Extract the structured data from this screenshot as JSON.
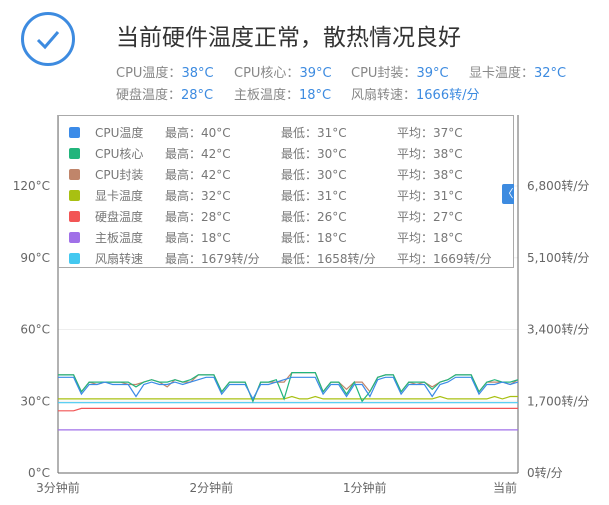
{
  "header": {
    "title": "当前硬件温度正常，散热情况良好",
    "summary": [
      {
        "label": "CPU温度：",
        "value": "38°C"
      },
      {
        "label": "CPU核心：",
        "value": "39°C"
      },
      {
        "label": "CPU封装：",
        "value": "39°C"
      },
      {
        "label": "显卡温度：",
        "value": "32°C"
      },
      {
        "label": "硬盘温度：",
        "value": "28°C"
      },
      {
        "label": "主板温度：",
        "value": "18°C"
      },
      {
        "label": "风扇转速：",
        "value": "1666转/分"
      }
    ]
  },
  "legend": {
    "toggle": "〈",
    "items": [
      {
        "name": "CPU温度",
        "max": "最高：40°C",
        "min": "最低：31°C",
        "avg": "平均：37°C",
        "color": "#3b8be8"
      },
      {
        "name": "CPU核心",
        "max": "最高：42°C",
        "min": "最低：30°C",
        "avg": "平均：38°C",
        "color": "#22b57c"
      },
      {
        "name": "CPU封装",
        "max": "最高：42°C",
        "min": "最低：30°C",
        "avg": "平均：38°C",
        "color": "#c0856a"
      },
      {
        "name": "显卡温度",
        "max": "最高：32°C",
        "min": "最低：31°C",
        "avg": "平均：31°C",
        "color": "#a8c012"
      },
      {
        "name": "硬盘温度",
        "max": "最高：28°C",
        "min": "最低：26°C",
        "avg": "平均：27°C",
        "color": "#f25555"
      },
      {
        "name": "主板温度",
        "max": "最高：18°C",
        "min": "最低：18°C",
        "avg": "平均：18°C",
        "color": "#a070e8"
      },
      {
        "name": "风扇转速",
        "max": "最高：1679转/分",
        "min": "最低：1658转/分",
        "avg": "平均：1669转/分",
        "color": "#44c8f0"
      }
    ]
  },
  "chart_data": {
    "type": "line",
    "x_ticks": [
      "3分钟前",
      "2分钟前",
      "1分钟前",
      "当前"
    ],
    "y_left": {
      "ticks": [
        "0°C",
        "30°C",
        "60°C",
        "90°C",
        "120°C"
      ],
      "range": [
        0,
        120
      ]
    },
    "y_right": {
      "ticks": [
        "0转/分",
        "1,700转/分",
        "3,400转/分",
        "5,100转/分",
        "6,800转/分"
      ],
      "range": [
        0,
        6800
      ]
    },
    "series": [
      {
        "name": "CPU温度",
        "axis": "left",
        "values": [
          40,
          40,
          40,
          33,
          37,
          37,
          38,
          37,
          37,
          37,
          32,
          37,
          38,
          37,
          37,
          38,
          37,
          38,
          39,
          40,
          40,
          33,
          37,
          37,
          37,
          31,
          37,
          37,
          38,
          39,
          40,
          40,
          40,
          40,
          33,
          37,
          37,
          32,
          37,
          37,
          32,
          39,
          40,
          40,
          33,
          37,
          37,
          37,
          32,
          37,
          38,
          40,
          40,
          40,
          33,
          37,
          37,
          38,
          37,
          38
        ]
      },
      {
        "name": "CPU核心",
        "axis": "left",
        "values": [
          41,
          41,
          41,
          34,
          38,
          38,
          38,
          38,
          38,
          38,
          36,
          38,
          39,
          38,
          38,
          39,
          38,
          39,
          41,
          41,
          41,
          34,
          38,
          38,
          38,
          30,
          38,
          38,
          39,
          31,
          42,
          42,
          42,
          42,
          34,
          38,
          38,
          33,
          38,
          30,
          34,
          40,
          41,
          41,
          34,
          38,
          38,
          38,
          35,
          38,
          39,
          41,
          41,
          41,
          34,
          38,
          39,
          38,
          38,
          39
        ]
      },
      {
        "name": "CPU封装",
        "axis": "left",
        "values": [
          41,
          41,
          41,
          34,
          38,
          37,
          38,
          38,
          38,
          37,
          37,
          38,
          39,
          38,
          36,
          39,
          38,
          38,
          41,
          41,
          41,
          34,
          38,
          38,
          38,
          30,
          38,
          38,
          38,
          38,
          42,
          42,
          42,
          42,
          34,
          38,
          38,
          35,
          38,
          38,
          34,
          40,
          41,
          41,
          34,
          38,
          37,
          38,
          36,
          38,
          39,
          41,
          41,
          41,
          34,
          38,
          38,
          38,
          37,
          39
        ]
      },
      {
        "name": "显卡温度",
        "axis": "left",
        "values": [
          31,
          31,
          31,
          31,
          31,
          31,
          31,
          31,
          31,
          31,
          31,
          31,
          31,
          31,
          31,
          31,
          31,
          31,
          31,
          31,
          31,
          31,
          31,
          31,
          31,
          31,
          31,
          31,
          31,
          31,
          32,
          31,
          31,
          32,
          31,
          31,
          31,
          31,
          31,
          31,
          31,
          31,
          31,
          31,
          31,
          31,
          31,
          31,
          31,
          32,
          31,
          31,
          31,
          31,
          31,
          31,
          32,
          31,
          32,
          32
        ]
      },
      {
        "name": "硬盘温度",
        "axis": "left",
        "values": [
          26,
          26,
          26,
          27,
          27,
          27,
          27,
          27,
          27,
          27,
          27,
          27,
          27,
          27,
          27,
          27,
          27,
          27,
          27,
          27,
          27,
          27,
          27,
          27,
          27,
          27,
          27,
          27,
          27,
          27,
          27,
          27,
          27,
          27,
          27,
          27,
          27,
          27,
          27,
          27,
          27,
          27,
          27,
          27,
          27,
          27,
          27,
          27,
          27,
          27,
          27,
          27,
          27,
          27,
          27,
          27,
          27,
          27,
          27,
          27
        ]
      },
      {
        "name": "主板温度",
        "axis": "left",
        "values": [
          18,
          18,
          18,
          18,
          18,
          18,
          18,
          18,
          18,
          18,
          18,
          18,
          18,
          18,
          18,
          18,
          18,
          18,
          18,
          18,
          18,
          18,
          18,
          18,
          18,
          18,
          18,
          18,
          18,
          18,
          18,
          18,
          18,
          18,
          18,
          18,
          18,
          18,
          18,
          18,
          18,
          18,
          18,
          18,
          18,
          18,
          18,
          18,
          18,
          18,
          18,
          18,
          18,
          18,
          18,
          18,
          18,
          18,
          18,
          18
        ]
      },
      {
        "name": "风扇转速",
        "axis": "right",
        "values": [
          1666,
          1666,
          1666,
          1666,
          1666,
          1666,
          1666,
          1666,
          1666,
          1666,
          1666,
          1666,
          1666,
          1666,
          1666,
          1666,
          1666,
          1666,
          1666,
          1666,
          1666,
          1666,
          1666,
          1666,
          1666,
          1666,
          1666,
          1666,
          1666,
          1666,
          1666,
          1666,
          1666,
          1666,
          1666,
          1666,
          1666,
          1666,
          1666,
          1666,
          1666,
          1666,
          1666,
          1666,
          1666,
          1666,
          1666,
          1666,
          1666,
          1666,
          1666,
          1666,
          1666,
          1666,
          1666,
          1666,
          1666,
          1666,
          1666,
          1666
        ]
      }
    ]
  }
}
